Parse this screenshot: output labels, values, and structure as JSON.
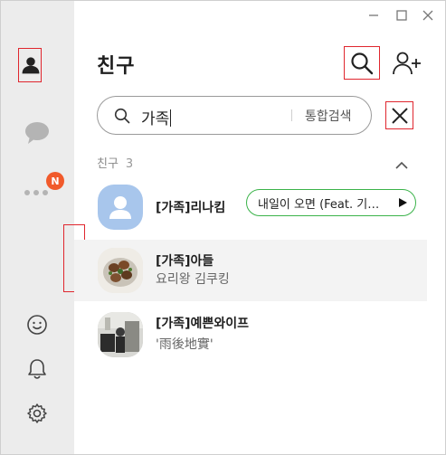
{
  "header": {
    "title": "친구"
  },
  "search": {
    "value": "가족",
    "unified_label": "통합검색"
  },
  "section": {
    "label": "친구",
    "count": "3"
  },
  "rail": {
    "more_badge": "N"
  },
  "friends": [
    {
      "name": "[가족]리나킴",
      "music": "내일이 오면 (Feat. 기리보이)"
    },
    {
      "name": "[가족]아들",
      "status": "요리왕 김쿠킹"
    },
    {
      "name": "[가족]예쁜와이프",
      "status": "'雨後地實'"
    }
  ],
  "colors": {
    "accent_red": "#e0262e",
    "badge": "#f15a2b",
    "music_border": "#3bb34a",
    "rail_bg": "#ececec"
  }
}
